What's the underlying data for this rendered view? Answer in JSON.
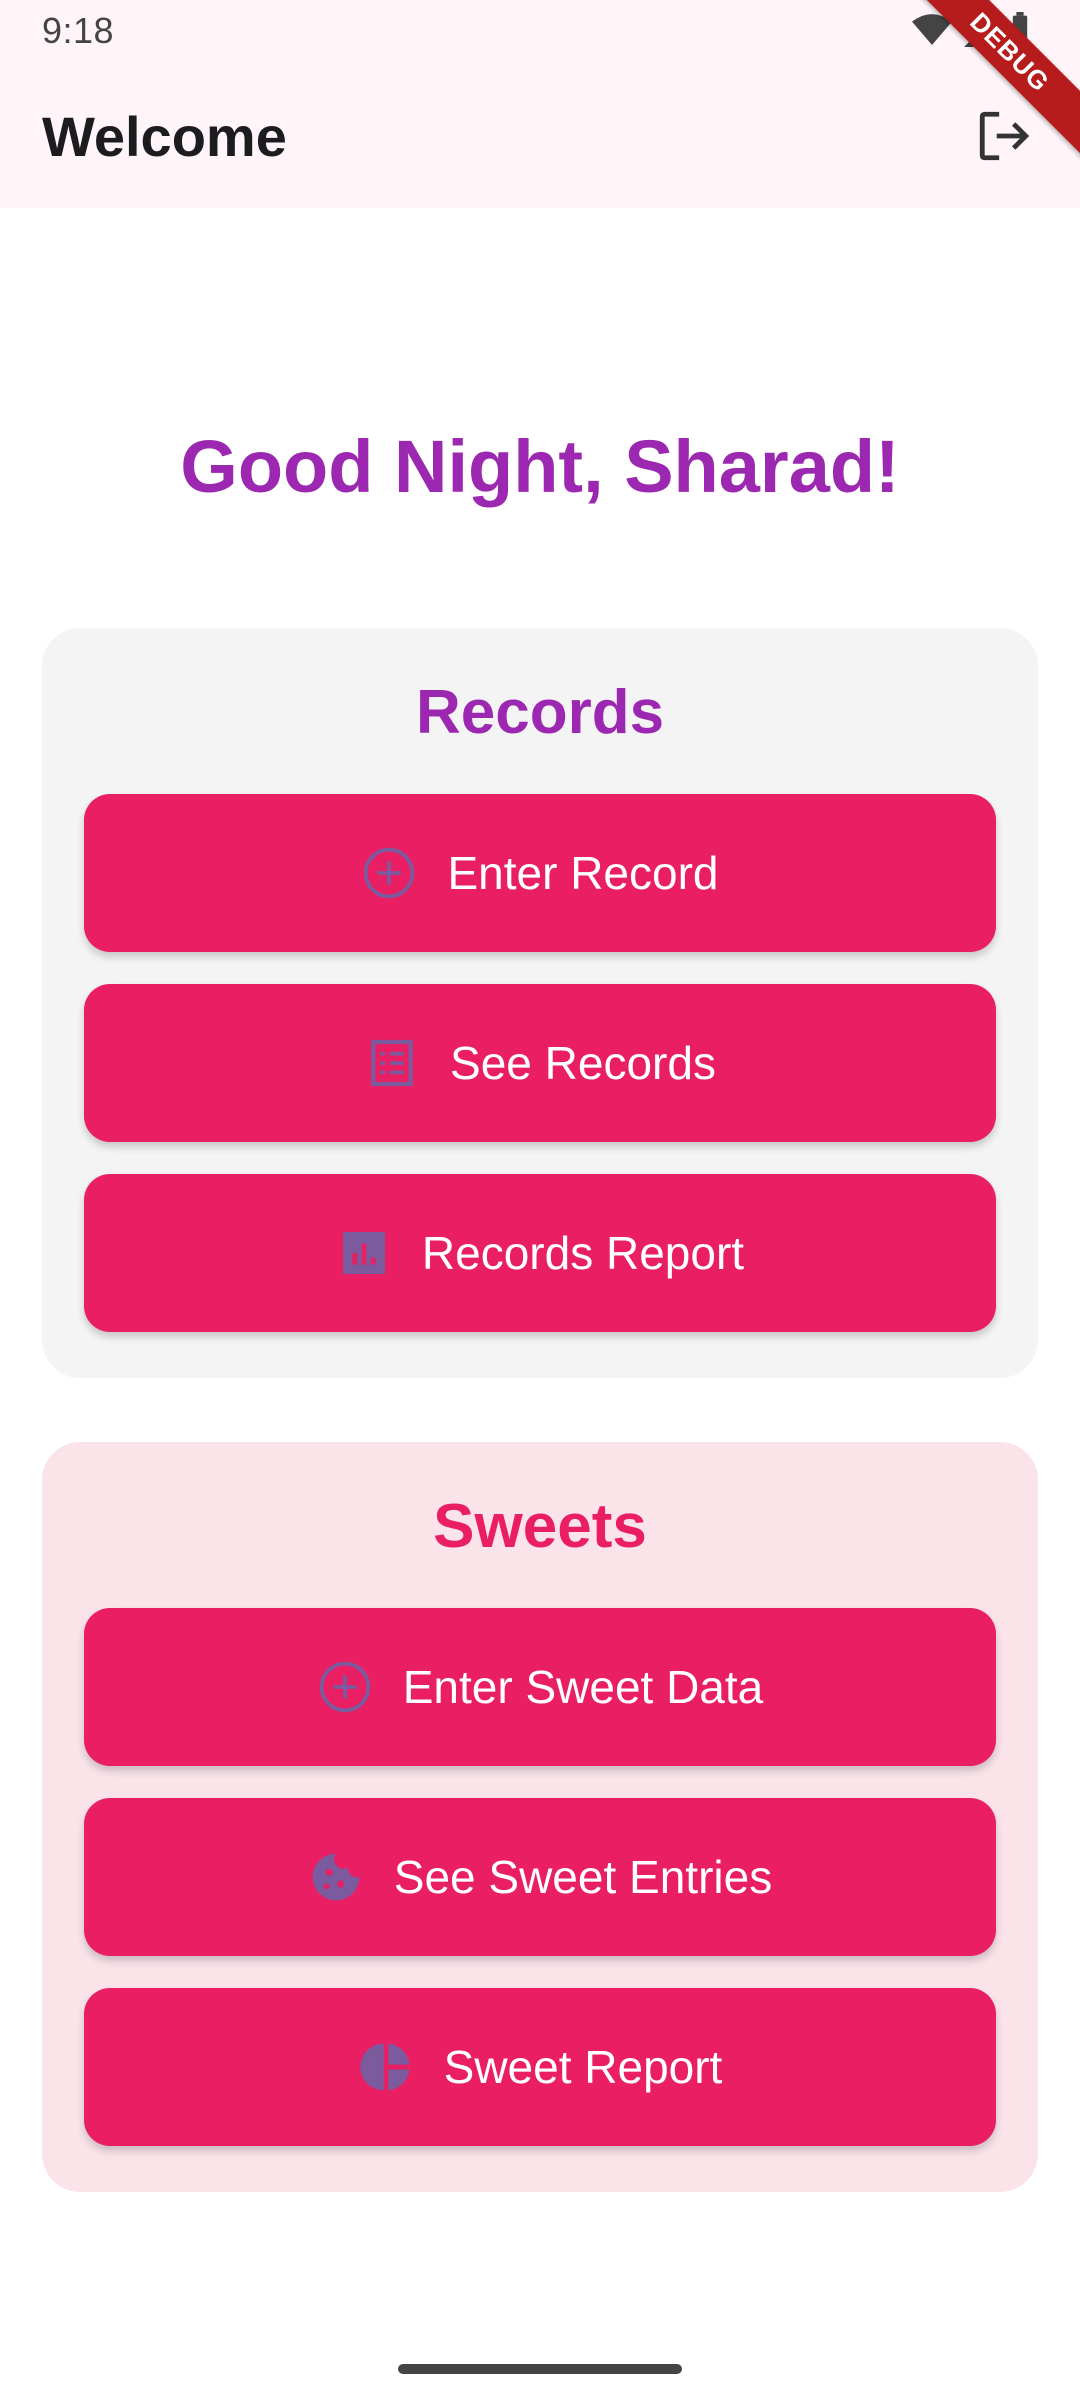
{
  "status_bar": {
    "time": "9:18"
  },
  "app_bar": {
    "title": "Welcome",
    "debug_label": "DEBUG"
  },
  "greeting": "Good Night, Sharad!",
  "records": {
    "title": "Records",
    "buttons": [
      {
        "label": "Enter Record",
        "icon": "add-circle-icon"
      },
      {
        "label": "See Records",
        "icon": "list-document-icon"
      },
      {
        "label": "Records Report",
        "icon": "bar-chart-icon"
      }
    ]
  },
  "sweets": {
    "title": "Sweets",
    "buttons": [
      {
        "label": "Enter Sweet Data",
        "icon": "add-circle-icon"
      },
      {
        "label": "See Sweet Entries",
        "icon": "cookie-icon"
      },
      {
        "label": "Sweet Report",
        "icon": "pie-chart-icon"
      }
    ]
  },
  "colors": {
    "primary": "#e91e63",
    "accent_purple": "#9c27b0",
    "icon_color": "#7b5a9e"
  }
}
